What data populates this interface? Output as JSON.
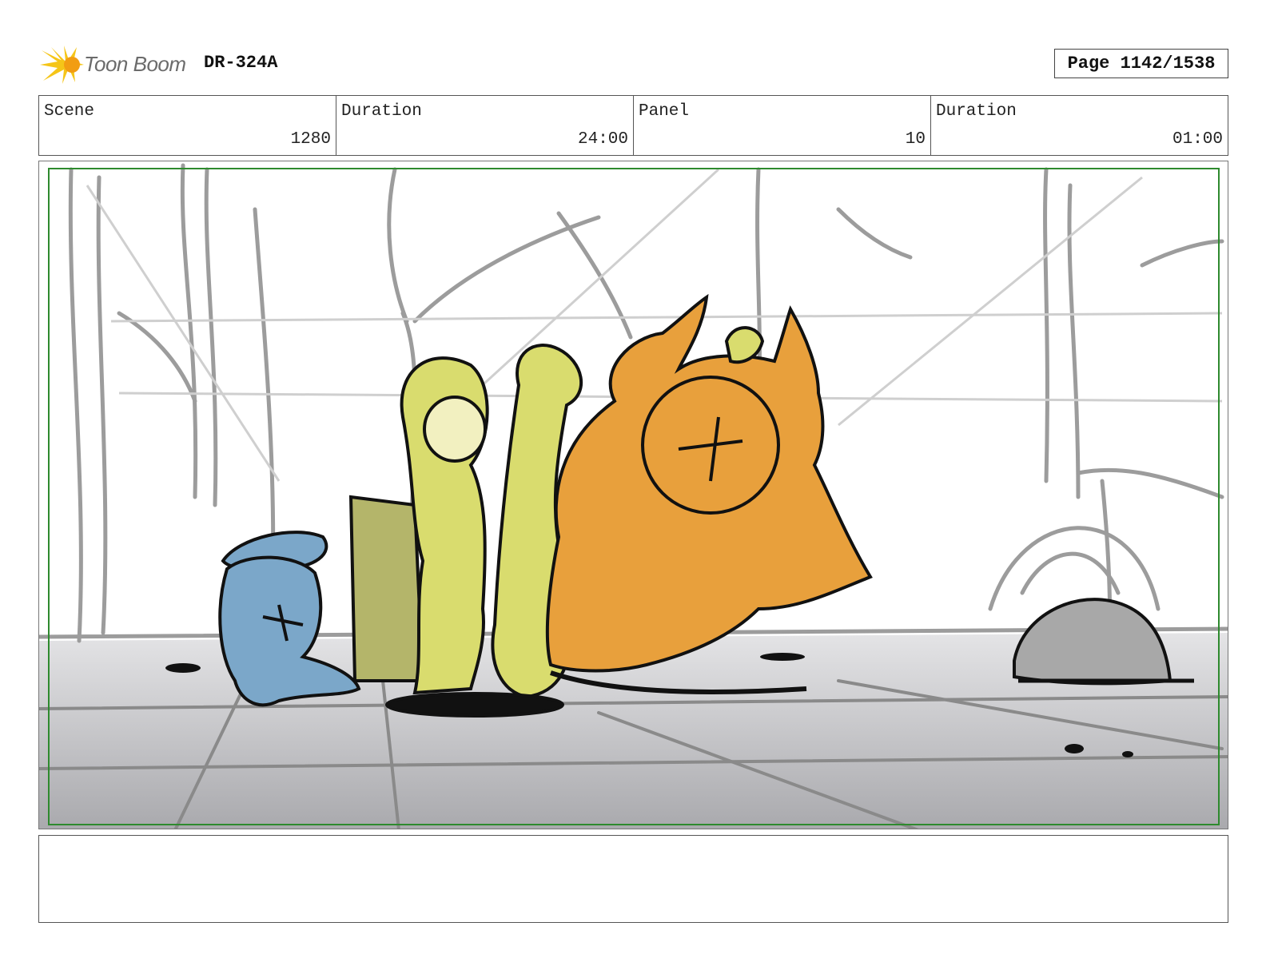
{
  "header": {
    "logo_text": "Toon Boom",
    "production_code": "DR-324A",
    "page_label": "Page 1142/1538"
  },
  "info": [
    {
      "label": "Scene",
      "value": "1280"
    },
    {
      "label": "Duration",
      "value": "24:00"
    },
    {
      "label": "Panel",
      "value": "10"
    },
    {
      "label": "Duration",
      "value": "01:00"
    }
  ],
  "panel": {
    "image_colors": {
      "blue_character": "#7ba7c9",
      "yellow_characters": "#d9dc6e",
      "orange_creature": "#e8a03c",
      "floor_gray": "#b8b8b8",
      "frame_green": "#2e8a2e"
    }
  },
  "notes": {
    "text": ""
  }
}
